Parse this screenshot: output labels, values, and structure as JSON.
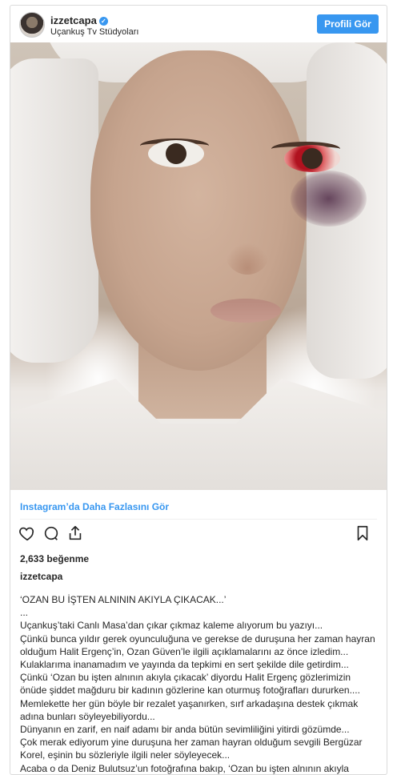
{
  "header": {
    "username": "izzetcapa",
    "location": "Uçankuş Tv Stüdyoları",
    "profile_button": "Profili Gör"
  },
  "more_link": "Instagram’da Daha Fazlasını Gör",
  "likes": "2,633 beğenme",
  "owner": "izzetcapa",
  "caption_lines": [
    "‘OZAN BU İŞTEN ALNININ AKIYLA ÇIKACAK...’",
    "...",
    "Uçankuş’taki Canlı Masa’dan çıkar çıkmaz kaleme alıyorum bu yazıyı...",
    "Çünkü bunca yıldır gerek oyunculuğuna ve gerekse de duruşuna her zaman hayran",
    "olduğum Halit Ergenç’in, Ozan Güven’le ilgili açıklamalarını az önce izledim...",
    "Kulaklarıma inanamadım ve yayında da tepkimi en sert şekilde dile getirdim...",
    "Çünkü ‘Ozan bu işten alnının akıyla çıkacak’ diyordu Halit Ergenç gözlerimizin",
    "önüde şiddet mağduru bir kadının gözlerine kan oturmuş fotoğrafları dururken....",
    "Memlekette her gün böyle bir rezalet yaşanırken, sırf arkadaşına destek çıkmak",
    "adına bunları söyleyebiliyordu...",
    "Dünyanın en zarif, en naif adamı bir anda bütün sevimliliğini yitirdi gözümde...",
    "Çok merak ediyorum yine duruşuna her zaman hayran olduğum sevgili Bergüzar",
    "Korel, eşinin bu sözleriyle ilgili neler söyleyecek...",
    "Acaba o da Deniz Bulutsuz’un fotoğrafına bakıp, ‘Ozan bu işten alnının akıyla"
  ],
  "icons": {
    "verified": "verified-badge-icon",
    "like": "heart-icon",
    "comment": "comment-bubble-icon",
    "share": "share-icon",
    "save": "bookmark-icon"
  },
  "colors": {
    "accent": "#3897f0",
    "text": "#262626",
    "border": "#dbdbdb"
  }
}
